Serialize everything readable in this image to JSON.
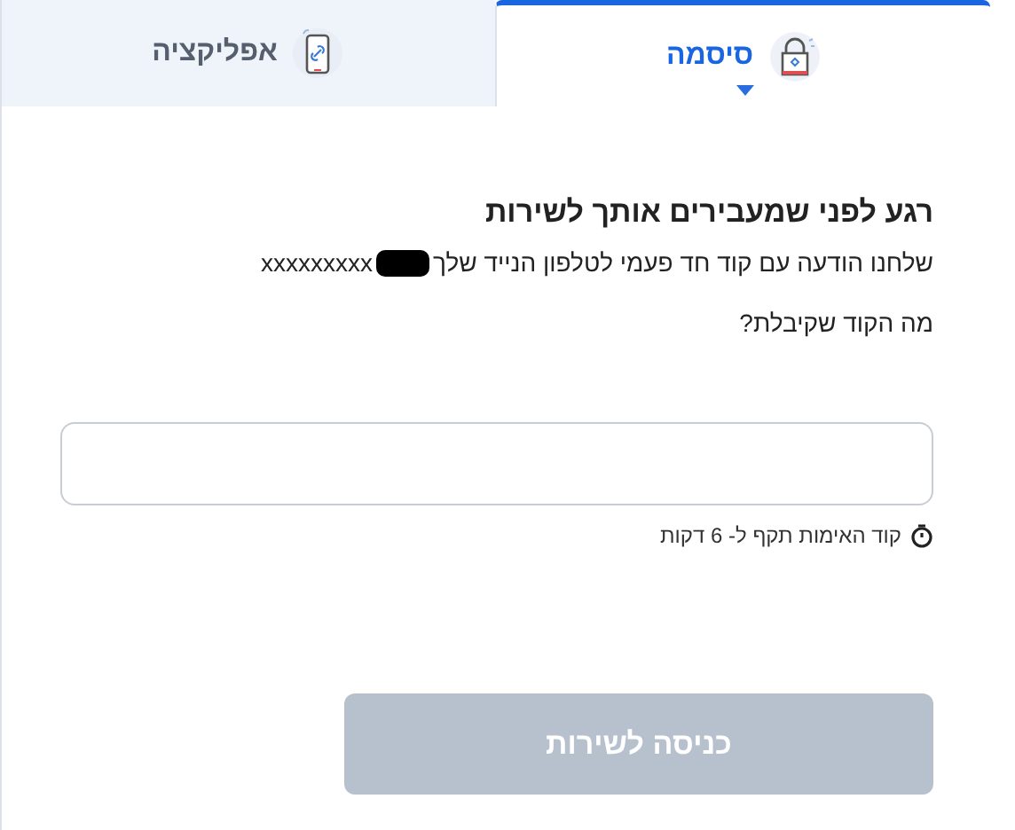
{
  "tabs": [
    {
      "label": "סיסמה",
      "kind": "lock",
      "selected": true
    },
    {
      "label": "אפליקציה",
      "kind": "phone",
      "selected": false
    }
  ],
  "heading": "רגע לפני שמעבירים אותך לשירות",
  "message": {
    "text": "שלחנו הודעה עם קוד חד פעמי לטלפון הנייד שלך",
    "phone": "xxxxxxxxx"
  },
  "question": "מה הקוד שקיבלת?",
  "timer_note": "קוד האימות תקף ל- 6 דקות",
  "submit": {
    "label": "כניסה לשירות",
    "disabled": true
  }
}
